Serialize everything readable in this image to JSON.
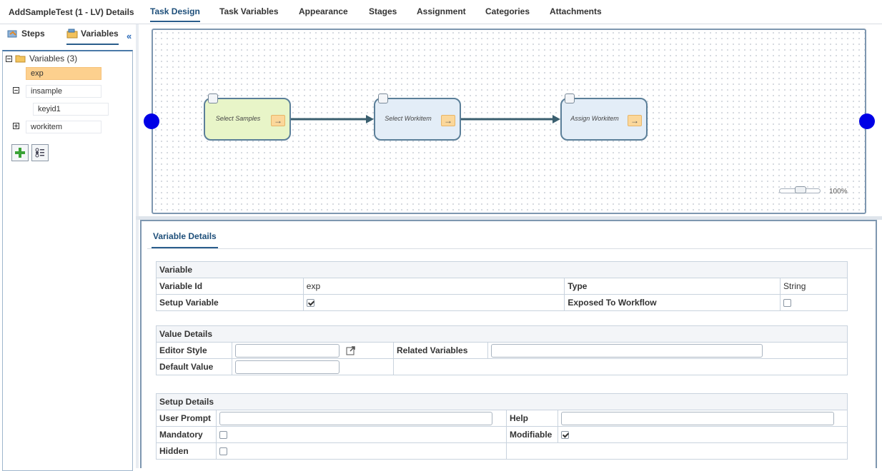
{
  "header": {
    "title": "AddSampleTest (1 - LV) Details",
    "tabs": [
      "Task Design",
      "Task Variables",
      "Appearance",
      "Stages",
      "Assignment",
      "Categories",
      "Attachments"
    ],
    "active_tab": "Task Design"
  },
  "sidebar": {
    "tabs": {
      "steps": "Steps",
      "variables": "Variables"
    },
    "active_tab": "Variables",
    "collapse_icon": "double-chevron-left-icon",
    "tree": {
      "root": "Variables (3)",
      "nodes": [
        {
          "label": "exp",
          "selected": true
        },
        {
          "label": "insample",
          "expanded": true,
          "children": [
            "keyid1"
          ]
        },
        {
          "label": "workitem",
          "expanded": false
        }
      ]
    },
    "buttons": {
      "add": "add-icon",
      "options": "list-options-icon"
    }
  },
  "canvas": {
    "steps": [
      {
        "label": "Select Samples",
        "color": "#e8f5c8"
      },
      {
        "label": "Select Workitem",
        "color": "#e3edf7"
      },
      {
        "label": "Assign Workitem",
        "color": "#e3edf7"
      }
    ],
    "zoom": "100%",
    "endpoint_color": "#0000e6"
  },
  "details": {
    "tab": "Variable Details",
    "variable": {
      "section": "Variable",
      "id_label": "Variable Id",
      "id_value": "exp",
      "type_label": "Type",
      "type_value": "String",
      "setup_label": "Setup Variable",
      "setup_checked": true,
      "exposed_label": "Exposed To Workflow",
      "exposed_checked": false
    },
    "value_details": {
      "section": "Value Details",
      "editor_style_label": "Editor Style",
      "related_label": "Related Variables",
      "default_label": "Default Value"
    },
    "setup_details": {
      "section": "Setup Details",
      "user_prompt_label": "User Prompt",
      "help_label": "Help",
      "mandatory_label": "Mandatory",
      "mandatory_checked": false,
      "modifiable_label": "Modifiable",
      "modifiable_checked": true,
      "hidden_label": "Hidden",
      "hidden_checked": false
    }
  }
}
